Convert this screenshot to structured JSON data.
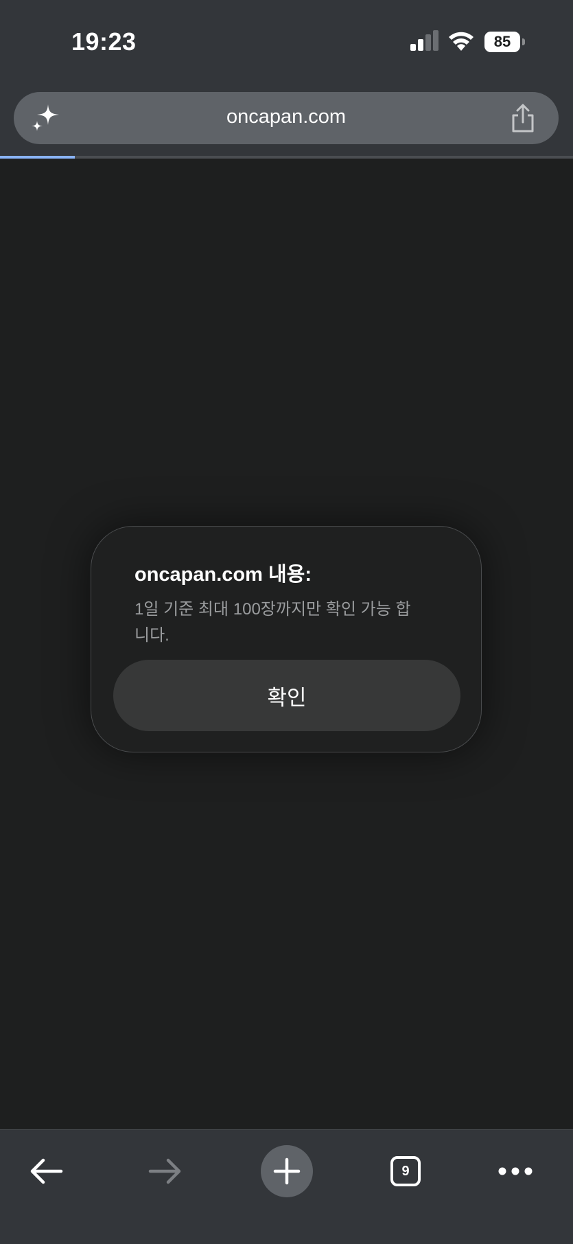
{
  "status_bar": {
    "time": "19:23",
    "battery_level": "85",
    "signal_icon": "cellular-signal-icon",
    "wifi_icon": "wifi-icon"
  },
  "browser": {
    "url": "oncapan.com",
    "load_progress": 0.13,
    "accent_color": "#8ab4f8"
  },
  "dialog": {
    "title": "oncapan.com 내용:",
    "message": "1일 기준 최대 100장까지만 확인 가능 합니다.",
    "confirm_label": "확인"
  },
  "toolbar": {
    "tab_count": "9",
    "back_icon": "arrow-left-icon",
    "forward_icon": "arrow-right-icon",
    "new_tab_icon": "plus-icon",
    "menu_icon": "more-dots-icon"
  }
}
